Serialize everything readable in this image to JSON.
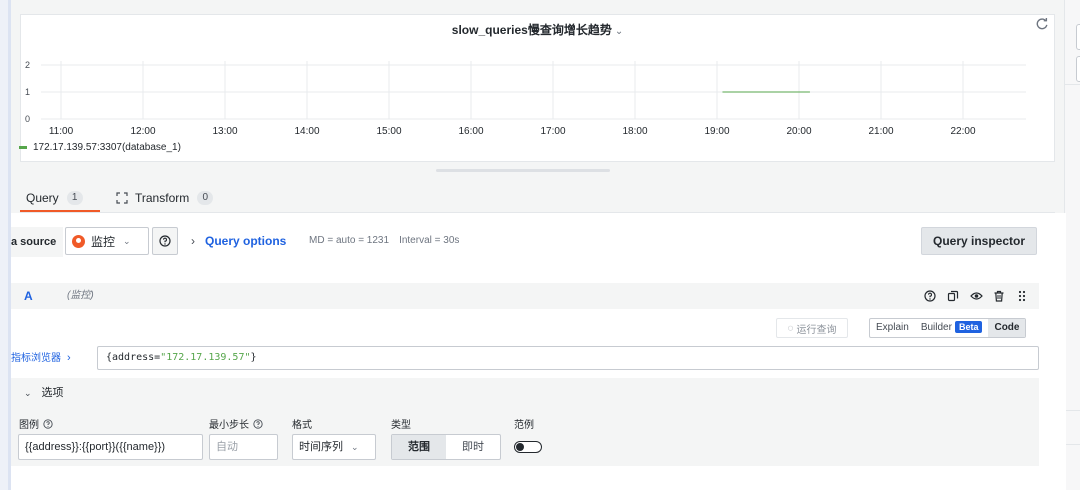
{
  "panel": {
    "title": "slow_queries慢查询增长趋势",
    "title_chevron": "⌄",
    "legend": "172.17.139.57:3307(database_1)"
  },
  "chart_data": {
    "type": "line",
    "x_ticks": [
      "11:00",
      "12:00",
      "13:00",
      "14:00",
      "15:00",
      "16:00",
      "17:00",
      "18:00",
      "19:00",
      "20:00",
      "21:00",
      "22:00"
    ],
    "y_ticks": [
      "0",
      "1",
      "2"
    ],
    "ylim": [
      0,
      2
    ],
    "series": [
      {
        "name": "172.17.139.57:3307(database_1)",
        "color": "#56a64b",
        "points": [
          {
            "x": "19:04",
            "y": 1
          },
          {
            "x": "20:08",
            "y": 1
          }
        ]
      }
    ]
  },
  "tabs": [
    {
      "label": "Query",
      "count": "1",
      "active": true
    },
    {
      "label": "Transform",
      "count": "0",
      "active": false
    }
  ],
  "datasource": {
    "label": "a source",
    "selected": "监控",
    "chevron": "⌄",
    "query_options_label": "Query options",
    "md": "MD = auto = 1231",
    "interval": "Interval = 30s",
    "inspector_label": "Query inspector"
  },
  "query": {
    "ref_id": "A",
    "datasource_name": "(监控)",
    "run_label": "运行查询",
    "modes": {
      "explain": "Explain",
      "builder": "Builder",
      "beta": "Beta",
      "code": "Code"
    },
    "metrics_browser": "指标浏览器",
    "expr_prefix": "{address=",
    "expr_value": "\"172.17.139.57\"",
    "expr_suffix": "}"
  },
  "options": {
    "section_label": "选项",
    "legend_label": "图例",
    "legend_value": "{{address}}:{{port}}({{name}})",
    "min_step_label": "最小步长",
    "min_step_placeholder": "自动",
    "format_label": "格式",
    "format_value": "时间序列",
    "type_label": "类型",
    "type_options": [
      "范围",
      "即时"
    ],
    "exemplar_label": "范例"
  },
  "colors": {
    "accent": "#1f62e0",
    "tab_active": "#f05a28",
    "series": "#56a64b"
  },
  "icons": {
    "refresh": "refresh-icon",
    "transform": "transform-icon",
    "help": "help-circle-icon",
    "duplicate": "duplicate-icon",
    "eye": "eye-icon",
    "trash": "trash-icon",
    "drag": "drag-handle-icon"
  }
}
